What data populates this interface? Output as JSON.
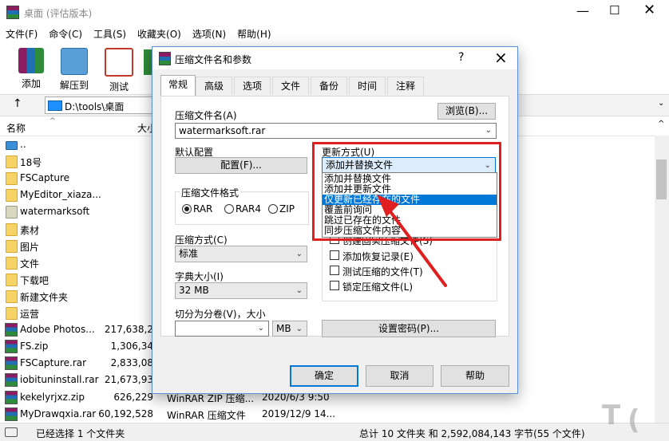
{
  "window": {
    "title": "桌面 (评估版本)"
  },
  "menu": [
    "文件(F)",
    "命令(C)",
    "工具(S)",
    "收藏夹(O)",
    "选项(N)",
    "帮助(H)"
  ],
  "toolbar": {
    "add": "添加",
    "extract": "解压到",
    "test": "测试"
  },
  "address": {
    "path": "D:\\tools\\桌面",
    "up": "↑"
  },
  "columns": {
    "name": "名称",
    "size": "大小"
  },
  "files": [
    {
      "name": "..",
      "kind": "up"
    },
    {
      "name": "18号",
      "kind": "folder"
    },
    {
      "name": "FSCapture",
      "kind": "folder"
    },
    {
      "name": "MyEditor_xiaza...",
      "kind": "folder"
    },
    {
      "name": "watermarksoft",
      "kind": "folder-gray"
    },
    {
      "name": "素材",
      "kind": "folder"
    },
    {
      "name": "图片",
      "kind": "folder"
    },
    {
      "name": "文件",
      "kind": "folder"
    },
    {
      "name": "下载吧",
      "kind": "folder"
    },
    {
      "name": "新建文件夹",
      "kind": "folder"
    },
    {
      "name": "运营",
      "kind": "folder"
    },
    {
      "name": "Adobe Photos...",
      "size": "217,638,2",
      "kind": "rar"
    },
    {
      "name": "FS.zip",
      "size": "1,306,34",
      "kind": "rar"
    },
    {
      "name": "FSCapture.rar",
      "size": "2,833,08",
      "kind": "rar"
    },
    {
      "name": "iobituninstall.rar",
      "size": "21,673,93",
      "kind": "rar"
    },
    {
      "name": "kekelyrjxz.zip",
      "size": "626,229",
      "type": "WinRAR ZIP 压缩...",
      "date": "2020/6/3 9:50",
      "kind": "rar"
    },
    {
      "name": "MyDrawqxia.rar",
      "size": "60,192,528",
      "type": "WinRAR 压缩文件",
      "date": "2019/12/9 14...",
      "kind": "rar"
    }
  ],
  "status": {
    "left": "已经选择 1 个文件夹",
    "right": "总计 10 文件夹 和 2,592,084,143 字节(55 个文件)"
  },
  "dialog": {
    "title": "压缩文件名和参数",
    "help": "?",
    "close": "×",
    "tabs": [
      "常规",
      "高级",
      "选项",
      "文件",
      "备份",
      "时间",
      "注释"
    ],
    "archive_name_label": "压缩文件名(A)",
    "archive_name_value": "watermarksoft.rar",
    "browse": "浏览(B)...",
    "default_profile_label": "默认配置",
    "profile_button": "配置(F)...",
    "update_mode_label": "更新方式(U)",
    "update_mode_value": "添加并替换文件",
    "update_options": [
      "添加并替换文件",
      "添加并更新文件",
      "仅更新已经存在的文件",
      "覆盖前询问",
      "跳过已存在的文件",
      "同步压缩文件内容"
    ],
    "selected_option_index": 2,
    "format_label": "压缩文件格式",
    "formats": [
      "RAR",
      "RAR4",
      "ZIP"
    ],
    "format_selected": "RAR",
    "method_label": "压缩方式(C)",
    "method_value": "标准",
    "dict_label": "字典大小(I)",
    "dict_value": "32 MB",
    "split_label": "切分为分卷(V)，大小",
    "split_value": "",
    "split_unit": "MB",
    "checkboxes": [
      "创建固实压缩文件(S)",
      "添加恢复记录(E)",
      "测试压缩的文件(T)",
      "锁定压缩文件(L)"
    ],
    "set_password": "设置密码(P)...",
    "ok": "确定",
    "cancel": "取消",
    "help_button": "帮助"
  },
  "colors": {
    "highlight": "#0078d7",
    "annotation": "#e02020"
  }
}
